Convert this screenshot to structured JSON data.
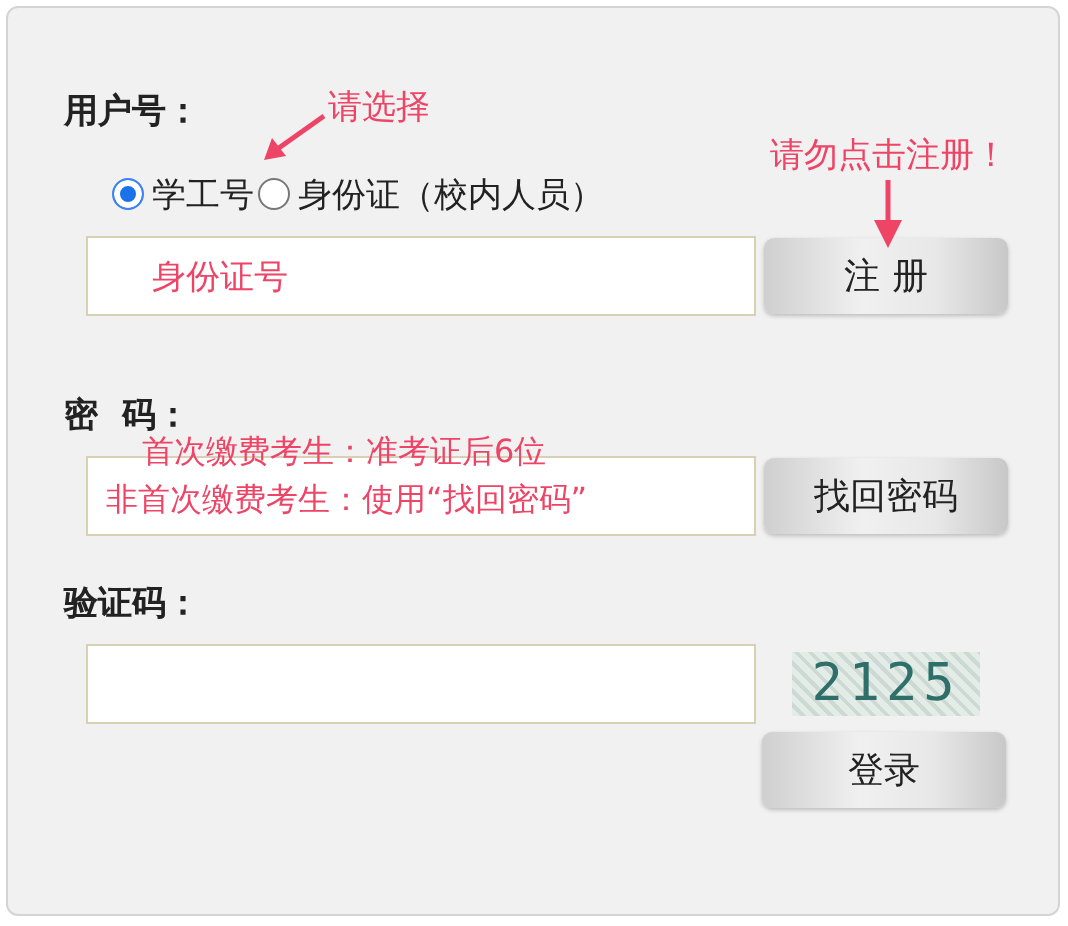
{
  "user": {
    "label": "用户号：",
    "hint": "请选择",
    "id_types": [
      {
        "label": "学工号",
        "selected": true
      },
      {
        "label": "身份证（校内人员）",
        "selected": false
      }
    ],
    "field_note": "身份证号",
    "button": "注 册",
    "button_note": "请勿点击注册！"
  },
  "password": {
    "label": "密  码：",
    "notes": [
      "首次缴费考生：准考证后6位",
      "非首次缴费考生：使用“找回密码”"
    ],
    "button": "找回密码"
  },
  "captcha": {
    "label": "验证码：",
    "code": "2125",
    "button": "登录"
  }
}
